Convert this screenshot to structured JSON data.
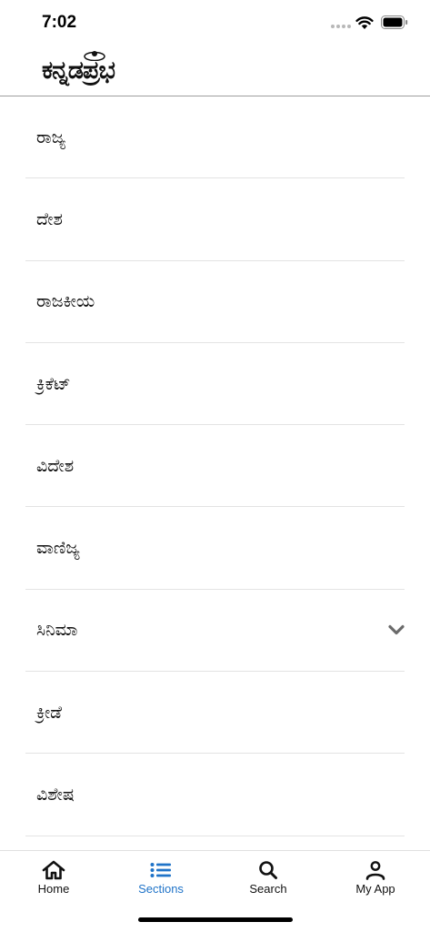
{
  "status_bar": {
    "time": "7:02"
  },
  "header": {
    "logo_text": "ಕನ್ನಡಪ್ರಭ"
  },
  "sections": [
    {
      "label": "ರಾಜ್ಯ",
      "expandable": false
    },
    {
      "label": "ದೇಶ",
      "expandable": false
    },
    {
      "label": "ರಾಜಕೀಯ",
      "expandable": false
    },
    {
      "label": "ಕ್ರಿಕೆಟ್",
      "expandable": false
    },
    {
      "label": "ವಿದೇಶ",
      "expandable": false
    },
    {
      "label": "ವಾಣಿಜ್ಯ",
      "expandable": false
    },
    {
      "label": "ಸಿನಿಮಾ",
      "expandable": true
    },
    {
      "label": "ಕ್ರೀಡೆ",
      "expandable": false
    },
    {
      "label": "ವಿಶೇಷ",
      "expandable": false
    }
  ],
  "tab_bar": {
    "tabs": [
      {
        "label": "Home",
        "icon": "home-icon",
        "active": false
      },
      {
        "label": "Sections",
        "icon": "list-icon",
        "active": true
      },
      {
        "label": "Search",
        "icon": "search-icon",
        "active": false
      },
      {
        "label": "My App",
        "icon": "person-icon",
        "active": false
      }
    ]
  },
  "colors": {
    "accent": "#1f73c8",
    "divider": "#e3e3e3",
    "chevron": "#6b6b6b"
  }
}
